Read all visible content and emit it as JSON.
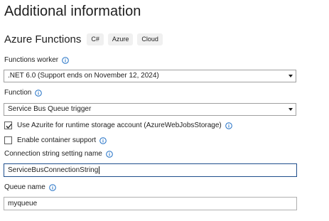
{
  "page_title": "Additional information",
  "section": {
    "title": "Azure Functions",
    "tags": [
      "C#",
      "Azure",
      "Cloud"
    ]
  },
  "functions_worker": {
    "label": "Functions worker",
    "selected": ".NET 6.0 (Support ends on November 12, 2024)"
  },
  "function": {
    "label": "Function",
    "selected": "Service Bus Queue trigger"
  },
  "use_azurite": {
    "label": "Use Azurite for runtime storage account (AzureWebJobsStorage)",
    "checked": true
  },
  "container_support": {
    "label": "Enable container support",
    "checked": false
  },
  "connection_string": {
    "label": "Connection string setting name",
    "value": "ServiceBusConnectionString"
  },
  "queue_name": {
    "label": "Queue name",
    "value": "myqueue"
  },
  "icons": {
    "info": "info-icon",
    "check": "check-icon",
    "dropdown": "chevron-down-icon"
  },
  "colors": {
    "info_icon": "#1f6fc5",
    "focus_border": "#1f4e8c"
  }
}
